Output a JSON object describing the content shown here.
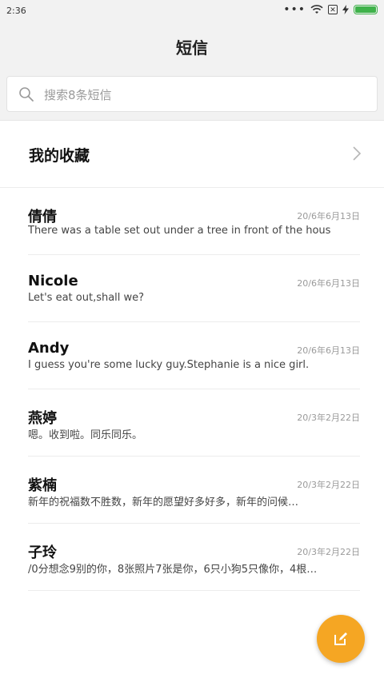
{
  "status": {
    "time": "2:36",
    "battery_level": 1.0
  },
  "header": {
    "title": "短信"
  },
  "search": {
    "placeholder": "搜索8条短信"
  },
  "favorites": {
    "label": "我的收藏"
  },
  "conversations": [
    {
      "name": "倩倩",
      "date": "20/6年6月13日",
      "snippet": "There was a table set out under a tree in front of the hous"
    },
    {
      "name": "Nicole",
      "date": "20/6年6月13日",
      "snippet": "Let's eat out,shall we?"
    },
    {
      "name": "Andy",
      "date": "20/6年6月13日",
      "snippet": "I guess you're some lucky guy.Stephanie is a nice girl."
    },
    {
      "name": "燕婷",
      "date": "20/3年2月22日",
      "snippet": "嗯。收到啦。同乐同乐。"
    },
    {
      "name": "紫楠",
      "date": "20/3年2月22日",
      "snippet": "新年的祝福数不胜数，新年的愿望好多好多，新年的问候…"
    },
    {
      "name": "子玲",
      "date": "20/3年2月22日",
      "snippet": "/0分想念9别的你，8张照片7张是你，6只小狗5只像你，4根…"
    }
  ],
  "colors": {
    "accent": "#f5a623",
    "battery": "#3fb24a"
  }
}
